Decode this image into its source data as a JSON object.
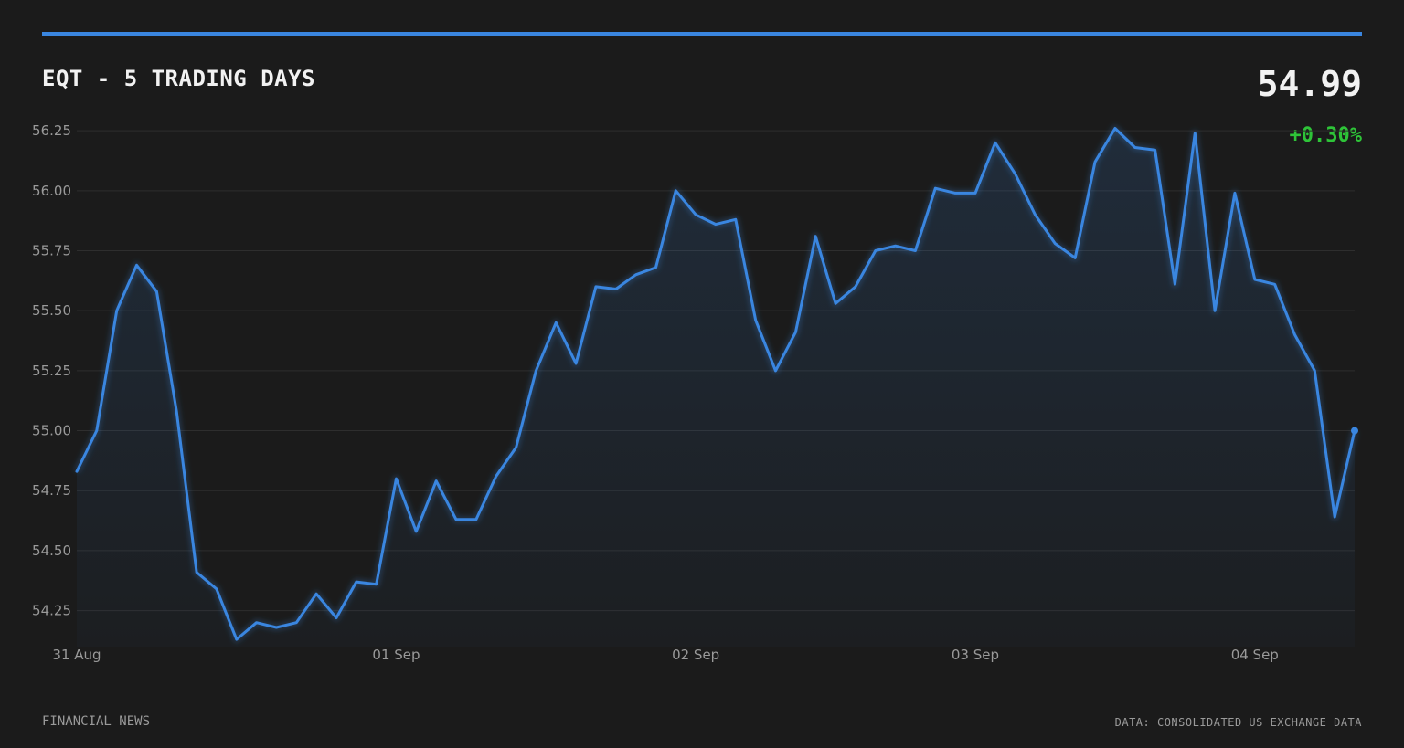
{
  "header": {
    "title": "EQT - 5 TRADING DAYS",
    "price": "54.99",
    "change": "+0.30%"
  },
  "footer": {
    "source_left": "FINANCIAL NEWS",
    "source_right": "DATA: CONSOLIDATED US EXCHANGE DATA"
  },
  "colors": {
    "background": "#1b1b1b",
    "line": "#3a86e0",
    "positive": "#2ec438",
    "grid": "#2e2e2e",
    "tick_text": "#9a9a9a"
  },
  "chart_data": {
    "type": "area",
    "title": "EQT - 5 TRADING DAYS",
    "xlabel": "",
    "ylabel": "",
    "ylim": [
      54.1,
      56.3
    ],
    "yticks": [
      54.25,
      54.5,
      54.75,
      55.0,
      55.25,
      55.5,
      55.75,
      56.0,
      56.25
    ],
    "ytick_labels": [
      "54.25",
      "54.50",
      "54.75",
      "55.00",
      "55.25",
      "55.50",
      "55.75",
      "56.00",
      "56.25"
    ],
    "xtick_labels": [
      "31 Aug",
      "01 Sep",
      "02 Sep",
      "03 Sep",
      "04 Sep"
    ],
    "xtick_positions": [
      0,
      16,
      31,
      45,
      59
    ],
    "grid": true,
    "series": [
      {
        "values": [
          54.83,
          55.0,
          55.5,
          55.69,
          55.58,
          55.08,
          54.41,
          54.34,
          54.13,
          54.2,
          54.18,
          54.2,
          54.32,
          54.22,
          54.37,
          54.36,
          54.8,
          54.58,
          54.79,
          54.63,
          54.63,
          54.81,
          54.93,
          55.25,
          55.45,
          55.28,
          55.6,
          55.59,
          55.65,
          55.68,
          56.0,
          55.9,
          55.86,
          55.88,
          55.46,
          55.25,
          55.41,
          55.81,
          55.53,
          55.6,
          55.75,
          55.77,
          55.75,
          56.01,
          55.99,
          55.99,
          56.2,
          56.07,
          55.9,
          55.78,
          55.72,
          56.12,
          56.26,
          56.18,
          56.17,
          55.61,
          56.24,
          55.5,
          55.99,
          55.63,
          55.61,
          55.4,
          55.25,
          54.64,
          55.0
        ]
      }
    ]
  }
}
